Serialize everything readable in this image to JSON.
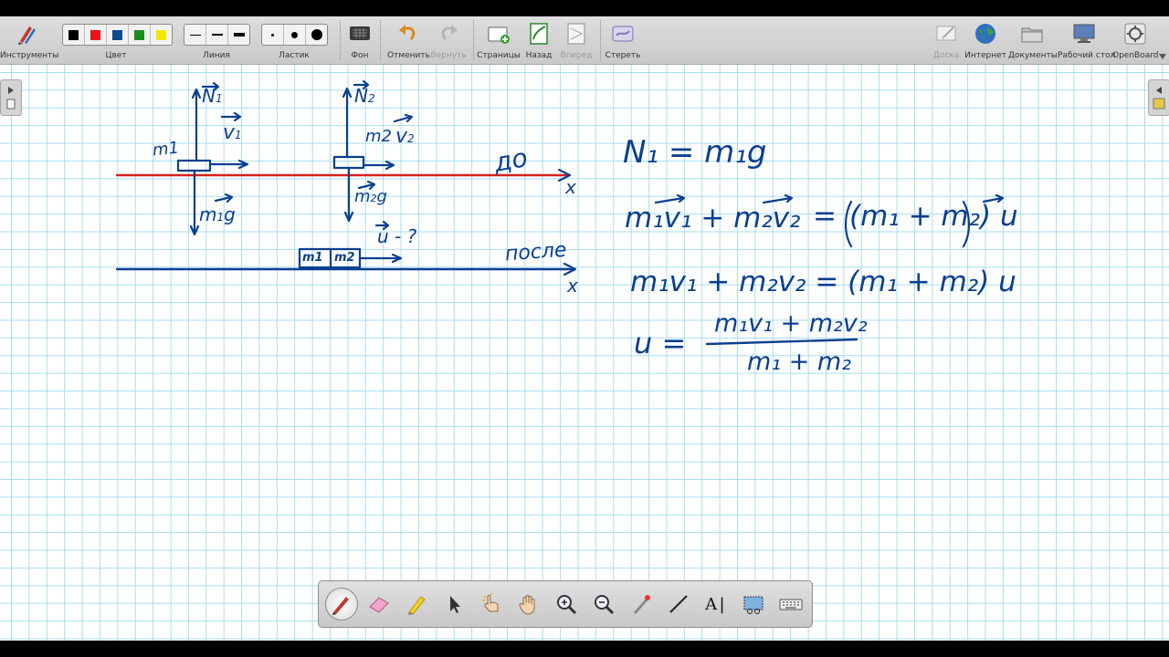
{
  "toolbar": {
    "tools_label": "Инструменты",
    "color_label": "Цвет",
    "line_label": "Линия",
    "eraser_label": "Ластик",
    "background_label": "Фон",
    "undo_label": "Отменить",
    "redo_label": "Вернуть",
    "pages_label": "Страницы",
    "back_label": "Назад",
    "forward_label": "Вперед",
    "clear_label": "Стереть",
    "board_label": "Доска",
    "internet_label": "Интернет",
    "documents_label": "Документы",
    "desktop_label": "Рабочий стол",
    "app_label": "OpenBoard",
    "colors": [
      "#000000",
      "#e8141b",
      "#0b4a8f",
      "#1d8e1d",
      "#f5e800"
    ]
  },
  "board": {
    "ink_color": "#0b3f8f",
    "red_line_color": "#d81e1e",
    "labels": {
      "m1": "m1",
      "m2": "m2",
      "before": "до",
      "after": "после",
      "x": "x",
      "u_question": "u - ?",
      "block_m1": "m1",
      "block_m2": "m2",
      "n1": "N",
      "n1_sub": "1",
      "n2": "N",
      "n2_sub": "2",
      "v1": "v",
      "v1_sub": "1",
      "v2": "v",
      "v2_sub": "2",
      "m1g": "m",
      "m1g_sub": "1",
      "m1g_g": "g",
      "m2g": "m",
      "m2g_sub": "2",
      "m2g_g": "g"
    },
    "equations": {
      "eq1": "N₁ = m₁g",
      "eq2_left": "m₁v₁ + m₂v₂",
      "eq2_eq": "=",
      "eq2_right": "(m₁ + m₂) u",
      "eq3": "m₁v₁ + m₂v₂ = (m₁ + m₂) u",
      "eq4_left": "u =",
      "eq4_num": "m₁v₁ + m₂v₂",
      "eq4_den": "m₁ + m₂"
    }
  },
  "palette": {
    "text_tool": "A"
  }
}
